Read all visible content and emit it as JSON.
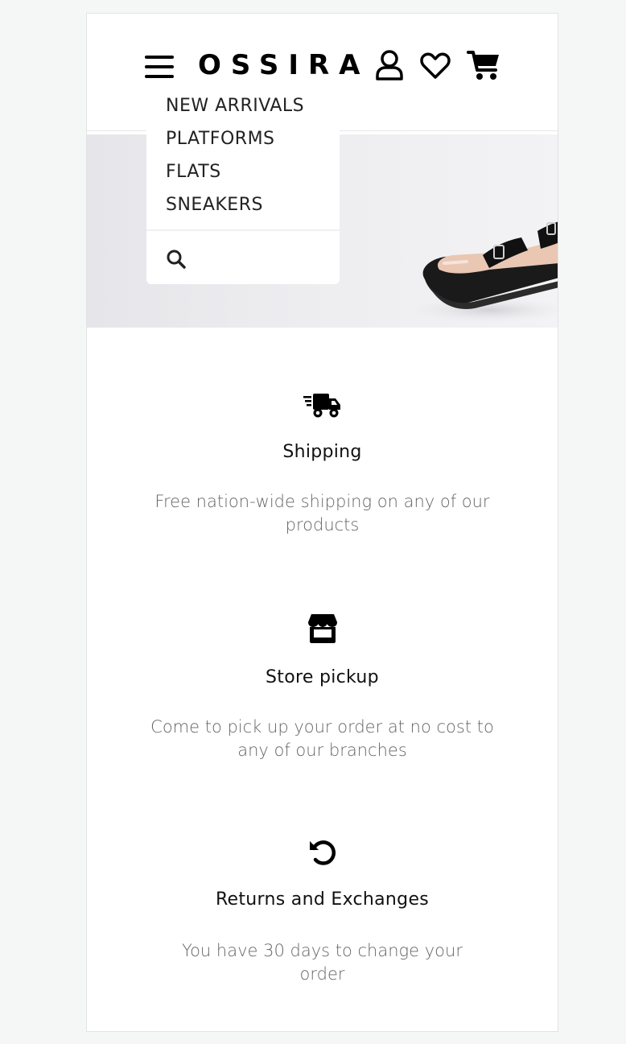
{
  "header": {
    "logo": "OSSIRA",
    "menu_icon": "hamburger-icon",
    "account_icon": "user-icon",
    "wishlist_icon": "heart-icon",
    "cart_icon": "cart-icon"
  },
  "menu": {
    "items": [
      {
        "label": "NEW ARRIVALS"
      },
      {
        "label": "PLATFORMS"
      },
      {
        "label": "FLATS"
      },
      {
        "label": "SNEAKERS"
      }
    ],
    "search_icon": "search-icon"
  },
  "features": [
    {
      "icon": "truck-fast-icon",
      "title": "Shipping",
      "description": "Free nation-wide shipping on any of our products"
    },
    {
      "icon": "store-icon",
      "title": "Store pickup",
      "description": "Come to pick up your order at no cost to any of our branches"
    },
    {
      "icon": "rotate-left-icon",
      "title": "Returns and Exchanges",
      "description": "You have 30 days to change your order"
    }
  ],
  "colors": {
    "background": "#f5f6f6",
    "text": "#111111",
    "muted_text": "#666666"
  }
}
